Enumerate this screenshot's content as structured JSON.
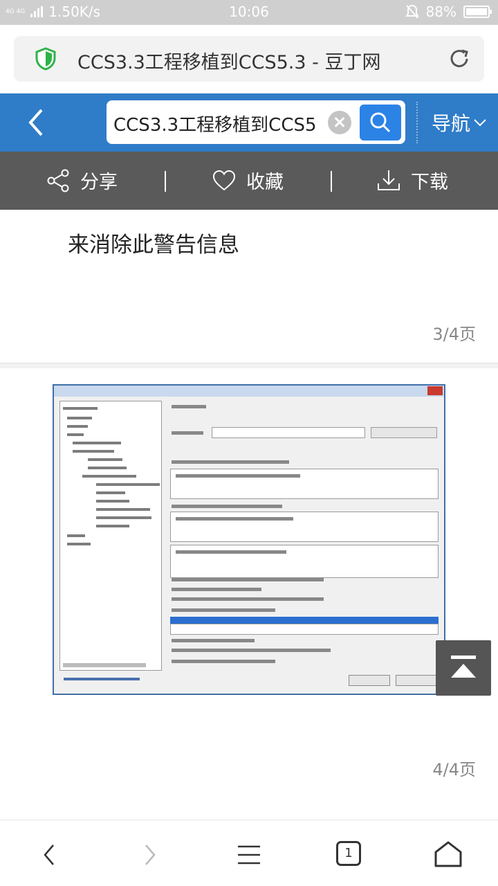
{
  "status_bar": {
    "network_label": "4G 4G",
    "speed": "1.50K/s",
    "time": "10:06",
    "battery": "88%",
    "battery_level": 0.88,
    "icons": [
      "signal-icon",
      "silent-bell-icon",
      "battery-icon"
    ]
  },
  "browser": {
    "page_title": "CCS3.3工程移植到CCS5.3 - 豆丁网",
    "secure_icon": "shield-icon",
    "reload_icon": "reload-icon"
  },
  "header": {
    "back_icon": "back-arrow-icon",
    "search_query": "CCS3.3工程移植到CCS5",
    "clear_icon": "clear-icon",
    "search_icon": "search-icon",
    "nav_label": "导航",
    "accent_color": "#2f7cc8"
  },
  "actions": {
    "share": "分享",
    "favorite": "收藏",
    "download": "下载"
  },
  "content": {
    "page3_text": "来消除此警告信息",
    "page3_number": "3/4页",
    "page4_number": "4/4页",
    "image_alt": "dialog-screenshot"
  },
  "bottom_nav": {
    "back_icon": "chevron-left-icon",
    "forward_icon": "chevron-right-icon",
    "menu_icon": "menu-icon",
    "tabs_count": "1",
    "home_icon": "home-icon"
  }
}
